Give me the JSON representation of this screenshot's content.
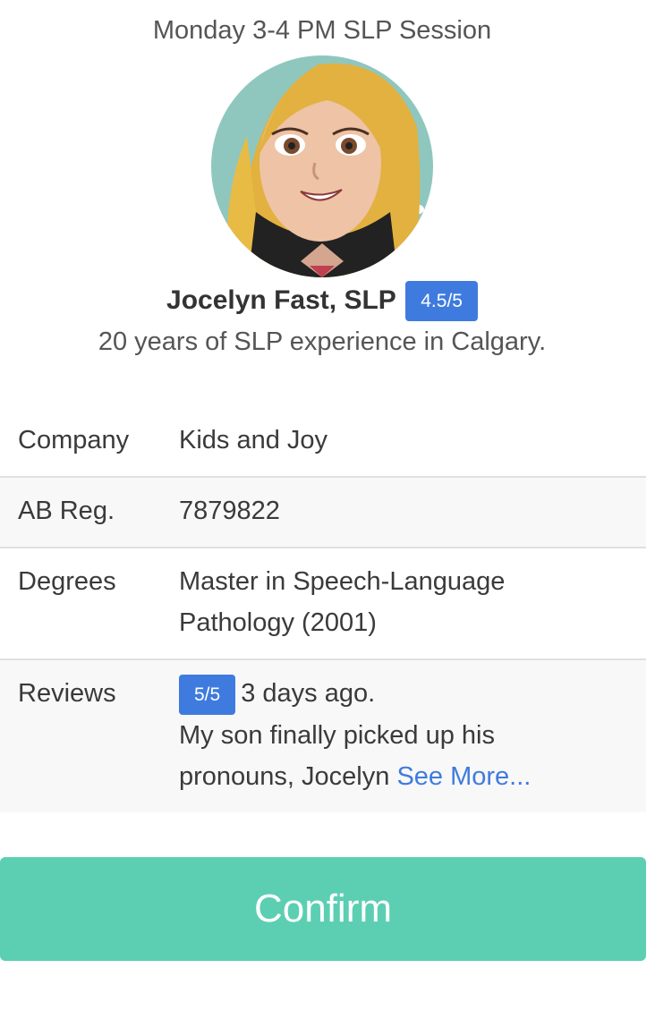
{
  "session": {
    "title": "Monday 3-4 PM SLP Session"
  },
  "provider": {
    "name": "Jocelyn Fast, SLP",
    "rating": "4.5/5",
    "experience": "20 years of SLP experience in Calgary.",
    "avatar_icon": "cartoon-avatar-icon"
  },
  "details": [
    {
      "label": "Company",
      "value": "Kids and Joy"
    },
    {
      "label": "AB Reg.",
      "value": "7879822"
    },
    {
      "label": "Degrees",
      "value": "Master in Speech-Language Pathology (2001)"
    }
  ],
  "reviews": {
    "label": "Reviews",
    "rating": "5/5",
    "age": "3 days ago.",
    "text": "My son finally picked up his pronouns, Jocelyn",
    "see_more": "See More..."
  },
  "actions": {
    "confirm_label": "Confirm"
  },
  "colors": {
    "accent_blue": "#3f7bde",
    "confirm_green": "#5ccfb2"
  }
}
